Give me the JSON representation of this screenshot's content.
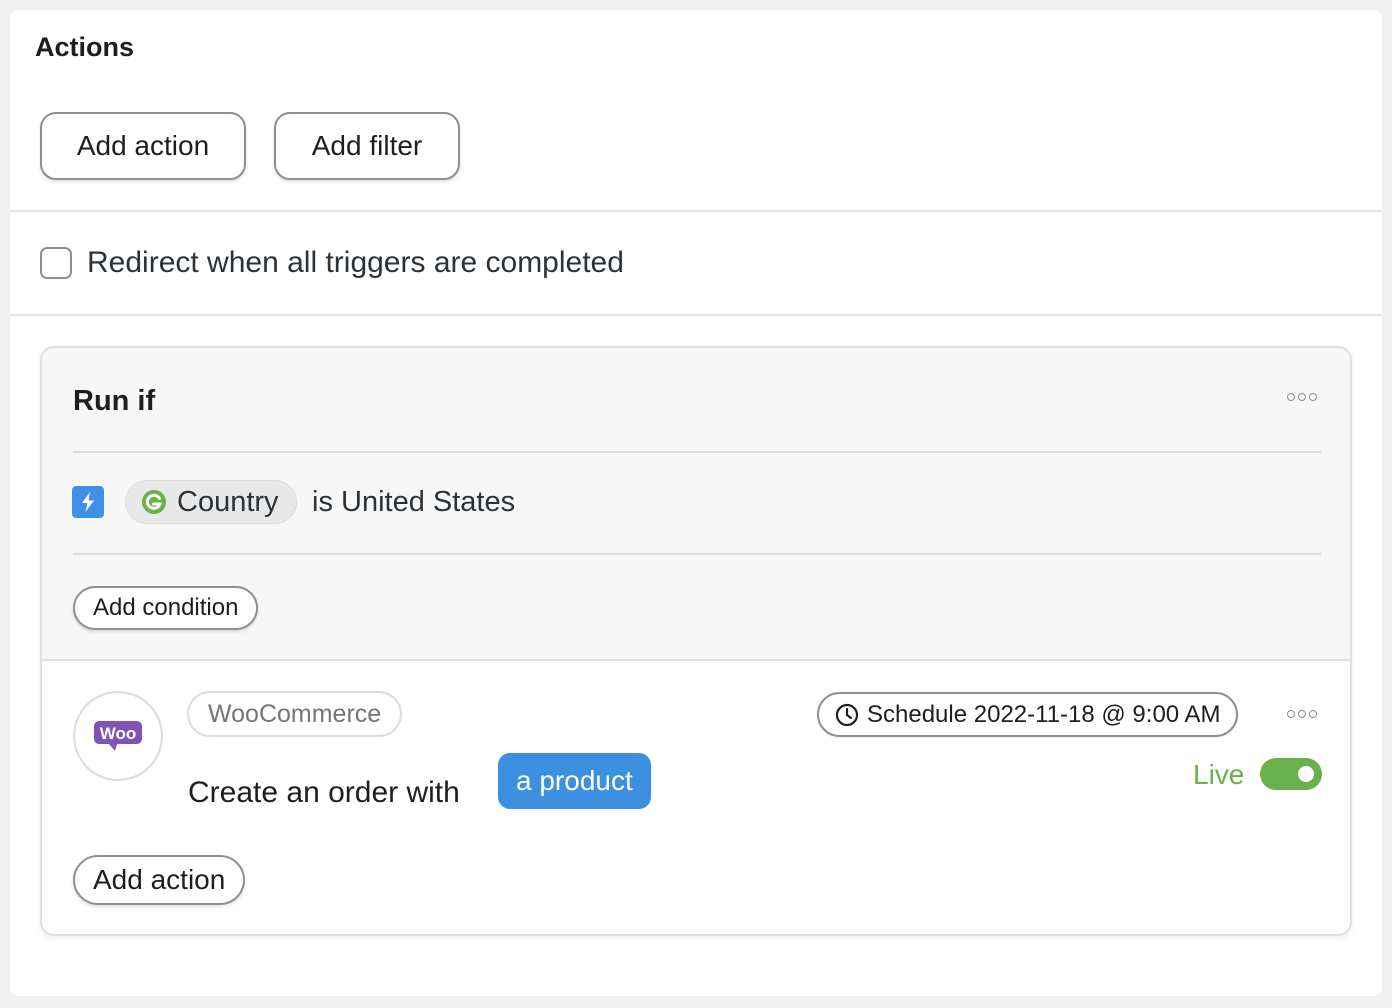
{
  "actions_panel": {
    "title": "Actions",
    "add_action_label": "Add action",
    "add_filter_label": "Add filter",
    "redirect_label": "Redirect when all triggers are completed",
    "redirect_checked": false
  },
  "run_if": {
    "title": "Run if",
    "condition": {
      "trigger_icon": "lightning-bolt-icon",
      "field_icon": "gravity-forms-icon",
      "field_label": "Country",
      "operator_value_text": "is United States"
    },
    "add_condition_label": "Add condition"
  },
  "action_step": {
    "app_icon": "woocommerce-logo-icon",
    "app_logo_text": "Woo",
    "app_name": "WooCommerce",
    "description": "Create an order with",
    "product_token": "a product",
    "schedule_icon": "clock-icon",
    "schedule_label": "Schedule 2022-11-18 @ 9:00 AM",
    "status_label": "Live",
    "status_on": true,
    "add_action_label": "Add action"
  },
  "colors": {
    "accent_blue": "#3d8fe0",
    "live_green": "#6ab04c",
    "woo_purple": "#7f54b3"
  }
}
